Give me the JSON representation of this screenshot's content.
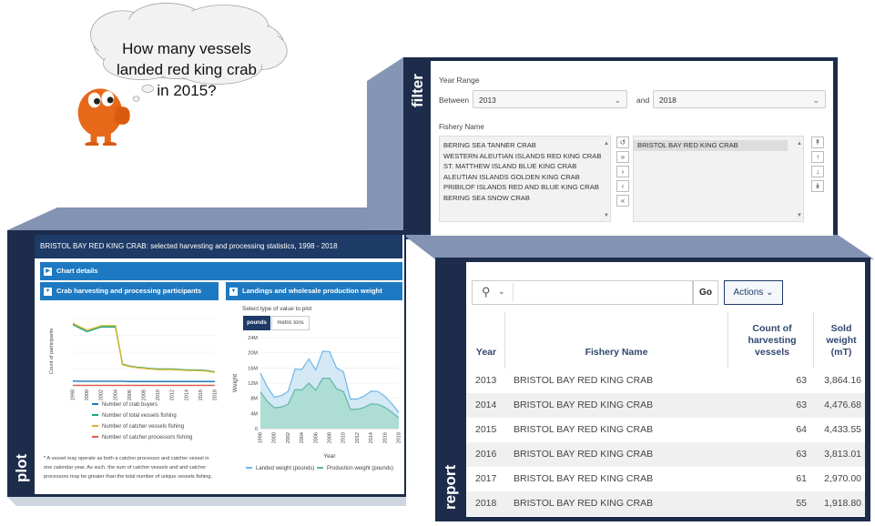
{
  "bubble": {
    "text_line1": "How many vessels",
    "text_line2": "landed red king crab",
    "text_line3": "in 2015?"
  },
  "side_labels": {
    "filter": "filter",
    "plot": "plot",
    "report": "report"
  },
  "filter": {
    "year_range_label": "Year Range",
    "between_label": "Between",
    "and_label": "and",
    "year_from": "2013",
    "year_to": "2018",
    "fishery_label": "Fishery Name",
    "available": [
      "BERING SEA TANNER CRAB",
      "WESTERN ALEUTIAN ISLANDS RED KING CRAB",
      "ST. MATTHEW ISLAND BLUE KING CRAB",
      "ALEUTIAN ISLANDS GOLDEN KING CRAB",
      "PRIBILOF ISLANDS RED AND BLUE KING CRAB",
      "BERING SEA SNOW CRAB"
    ],
    "selected": [
      "BRISTOL BAY RED KING CRAB"
    ]
  },
  "plot": {
    "header": "BRISTOL BAY RED KING CRAB: selected harvesting and processing statistics, 1998 - 2018",
    "chart_details": "Chart details",
    "left_title": "Crab harvesting and processing participants",
    "right_title": "Landings and wholesale production weight",
    "select_label": "Select type of value to plot",
    "btn_pounds": "pounds",
    "btn_metric": "metric tons",
    "note": "* A vessel may operate as both a catcher processor and catcher vessel in one calendar year. As such, the sum of catcher vessels and and catcher processors may be greater than the total number of unique vessels fishing."
  },
  "chart_data": [
    {
      "type": "line",
      "ylabel": "Count of participants",
      "x": [
        1998,
        1999,
        2000,
        2001,
        2002,
        2003,
        2004,
        2005,
        2006,
        2007,
        2008,
        2009,
        2010,
        2011,
        2012,
        2013,
        2014,
        2015,
        2016,
        2017,
        2018
      ],
      "xticks": [
        "1998",
        "2000",
        "2002",
        "2004",
        "2006",
        "2008",
        "2010",
        "2012",
        "2014",
        "2016",
        "2018"
      ],
      "series": [
        {
          "name": "Number of crab buyers",
          "color": "#1f77b4",
          "values": [
            20,
            19,
            19,
            19,
            19,
            19,
            19,
            19,
            18,
            18,
            18,
            18,
            18,
            18,
            18,
            18,
            18,
            18,
            18,
            18,
            18
          ]
        },
        {
          "name": "Number of total vessels fishing",
          "color": "#17a589",
          "values": [
            255,
            240,
            225,
            235,
            245,
            245,
            245,
            90,
            82,
            78,
            75,
            72,
            70,
            70,
            70,
            68,
            66,
            66,
            65,
            63,
            58
          ]
        },
        {
          "name": "Number of catcher vessels fishing",
          "color": "#d4b62a",
          "values": [
            260,
            245,
            232,
            240,
            250,
            250,
            250,
            88,
            80,
            76,
            73,
            70,
            68,
            68,
            68,
            66,
            64,
            64,
            63,
            61,
            56
          ]
        },
        {
          "name": "Number of catcher processors fishing",
          "color": "#e05a4a",
          "values": [
            2,
            2,
            2,
            2,
            2,
            2,
            2,
            2,
            2,
            2,
            2,
            2,
            2,
            2,
            2,
            2,
            2,
            2,
            2,
            2,
            2
          ]
        }
      ]
    },
    {
      "type": "area",
      "xlabel": "Year",
      "ylabel": "Weight",
      "ylim": [
        0,
        24000000
      ],
      "yticks": [
        "0",
        "4M",
        "8M",
        "12M",
        "16M",
        "20M",
        "24M"
      ],
      "x": [
        1998,
        1999,
        2000,
        2001,
        2002,
        2003,
        2004,
        2005,
        2006,
        2007,
        2008,
        2009,
        2010,
        2011,
        2012,
        2013,
        2014,
        2015,
        2016,
        2017,
        2018
      ],
      "xticks": [
        "1998",
        "2000",
        "2002",
        "2004",
        "2006",
        "2008",
        "2010",
        "2012",
        "2014",
        "2016",
        "2018"
      ],
      "series": [
        {
          "name": "Landed weight (pounds)",
          "color": "#6fb7e6",
          "values": [
            14700000,
            11000000,
            8300000,
            8700000,
            9800000,
            15700000,
            15600000,
            18400000,
            15500000,
            20400000,
            20300000,
            16000000,
            15000000,
            7800000,
            7800000,
            8600000,
            9900000,
            9800000,
            8500000,
            6600000,
            4300000
          ]
        },
        {
          "name": "Production weight (pounds)",
          "color": "#5fb8a8",
          "values": [
            9700000,
            7200000,
            5500000,
            5700000,
            6400000,
            10300000,
            10200000,
            12000000,
            10100000,
            13300000,
            13300000,
            10500000,
            9800000,
            5100000,
            5100000,
            5600000,
            6500000,
            6400000,
            5600000,
            4300000,
            2800000
          ]
        }
      ]
    }
  ],
  "report": {
    "go_label": "Go",
    "actions_label": "Actions",
    "col_year": "Year",
    "col_fishery": "Fishery Name",
    "col_count": "Count of harvesting vessels",
    "col_sold": "Sold weight (mT)",
    "rows": [
      {
        "year": "2013",
        "fishery": "BRISTOL BAY RED KING CRAB",
        "count": "63",
        "sold": "3,864.16"
      },
      {
        "year": "2014",
        "fishery": "BRISTOL BAY RED KING CRAB",
        "count": "63",
        "sold": "4,476.68"
      },
      {
        "year": "2015",
        "fishery": "BRISTOL BAY RED KING CRAB",
        "count": "64",
        "sold": "4,433.55"
      },
      {
        "year": "2016",
        "fishery": "BRISTOL BAY RED KING CRAB",
        "count": "63",
        "sold": "3,813.01"
      },
      {
        "year": "2017",
        "fishery": "BRISTOL BAY RED KING CRAB",
        "count": "61",
        "sold": "2,970.00"
      },
      {
        "year": "2018",
        "fishery": "BRISTOL BAY RED KING CRAB",
        "count": "55",
        "sold": "1,918.80"
      }
    ]
  }
}
